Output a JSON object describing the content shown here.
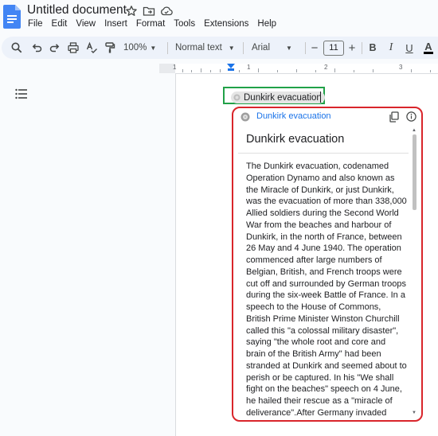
{
  "title_bar": {
    "doc_title": "Untitled document",
    "icons": [
      "star-icon",
      "move-folder-icon",
      "cloud-status-icon"
    ]
  },
  "menu": [
    "File",
    "Edit",
    "View",
    "Insert",
    "Format",
    "Tools",
    "Extensions",
    "Help"
  ],
  "toolbar": {
    "zoom": "100%",
    "style": "Normal text",
    "font": "Arial",
    "font_size": "11",
    "minus": "−",
    "plus": "+",
    "bold": "B",
    "italic": "I",
    "underline": "U",
    "text_color": "A"
  },
  "ruler": {
    "numbers": [
      "1",
      "1",
      "2",
      "3"
    ]
  },
  "chip": {
    "label": "Dunkirk evacuation"
  },
  "card": {
    "source": "Dunkirk evacuation",
    "title": "Dunkirk evacuation",
    "body_lines": [
      "The Dunkirk evacuation, codenamed",
      "Operation Dynamo and also known as",
      "the Miracle of Dunkirk, or just Dunkirk,",
      "was the evacuation of more than 338,000",
      "Allied soldiers during the Second World",
      "War from the beaches and harbour of",
      "Dunkirk, in the north of France, between",
      "26 May and 4 June 1940. The operation",
      "commenced after large numbers of",
      "Belgian, British, and French troops were",
      "cut off and surrounded by German troops",
      "during the six-week Battle of France. In a",
      "speech to the House of Commons,",
      "British Prime Minister Winston Churchill",
      "called this \"a colossal military disaster\",",
      "saying \"the whole root and core and",
      "brain of the British Army\" had been",
      "stranded at Dunkirk and seemed about to",
      "perish or be captured. In his \"We shall",
      "fight on the beaches\" speech on 4 June,",
      "he hailed their rescue as a \"miracle of",
      "deliverance\".After Germany invaded"
    ]
  },
  "colors": {
    "chip_highlight": "#21a148",
    "card_highlight": "#d9252b",
    "link_blue": "#1a73e8",
    "toolbar_bg": "#edf2fa",
    "docs_blue": "#4285f4"
  }
}
